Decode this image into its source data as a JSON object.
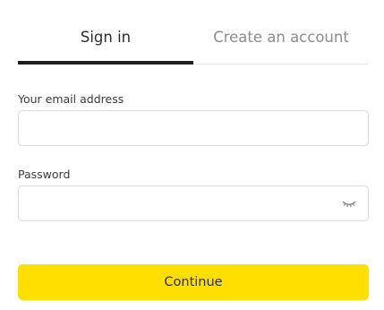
{
  "tabs": {
    "sign_in": "Sign in",
    "create_account": "Create an account"
  },
  "form": {
    "email_label": "Your email address",
    "email_value": "",
    "password_label": "Password",
    "password_value": "",
    "password_toggle_icon": "eye-closed-icon",
    "continue_label": "Continue"
  },
  "colors": {
    "accent": "#ffdf00",
    "active_tab": "#1e1e1e",
    "inactive_tab_text": "#8c8c8c"
  }
}
